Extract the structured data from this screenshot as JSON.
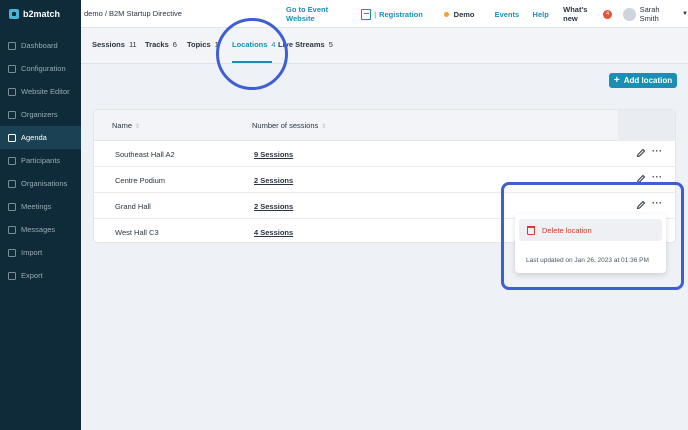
{
  "brand": {
    "name": "b2match"
  },
  "sidebar": {
    "items": [
      {
        "label": "Dashboard",
        "icon": "dashboard-icon",
        "active": false
      },
      {
        "label": "Configuration",
        "icon": "gear-icon",
        "active": false
      },
      {
        "label": "Website Editor",
        "icon": "edit-icon",
        "active": false
      },
      {
        "label": "Organizers",
        "icon": "users-icon",
        "active": false
      },
      {
        "label": "Agenda",
        "icon": "calendar-icon",
        "active": true
      },
      {
        "label": "Participants",
        "icon": "user-icon",
        "active": false
      },
      {
        "label": "Organisations",
        "icon": "building-icon",
        "active": false
      },
      {
        "label": "Meetings",
        "icon": "meeting-icon",
        "active": false
      },
      {
        "label": "Messages",
        "icon": "chat-icon",
        "active": false
      },
      {
        "label": "Import",
        "icon": "import-icon",
        "active": false
      },
      {
        "label": "Export",
        "icon": "export-icon",
        "active": false
      }
    ]
  },
  "topbar": {
    "breadcrumb": "demo / B2M Startup Directive",
    "go_to_event": "Go to Event Website",
    "separator": "|",
    "registration": "Registration",
    "demo_label": "Demo",
    "events": "Events",
    "help": "Help",
    "whats_new": "What's new",
    "whats_new_badge": "4",
    "user_name": "Sarah Smith",
    "status_color": "#f0a03a"
  },
  "tabs": [
    {
      "label": "Sessions",
      "count": "11"
    },
    {
      "label": "Tracks",
      "count": "6"
    },
    {
      "label": "Topics",
      "count": "1"
    },
    {
      "label": "Locations",
      "count": "4",
      "active": true
    },
    {
      "label": "Live Streams",
      "count": "5"
    }
  ],
  "actions": {
    "add_location": "Add location"
  },
  "table": {
    "columns": [
      "Name",
      "Number of sessions"
    ],
    "rows": [
      {
        "name": "Southeast Hall A2",
        "sessions": "9 Sessions"
      },
      {
        "name": "Centre Podium",
        "sessions": "2 Sessions"
      },
      {
        "name": "Grand Hall",
        "sessions": "2 Sessions"
      },
      {
        "name": "West Hall C3",
        "sessions": "4 Sessions"
      }
    ]
  },
  "dropdown": {
    "delete_label": "Delete location",
    "last_updated": "Last updated on Jan 26, 2023 at 01:36 PM"
  },
  "colors": {
    "accent": "#1b8fb3",
    "sidebar_bg": "#0f2b3a",
    "danger": "#d23c2f",
    "highlight": "#3d5fd1"
  }
}
